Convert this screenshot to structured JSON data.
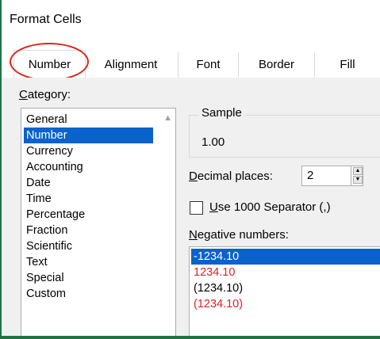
{
  "window": {
    "title": "Format Cells"
  },
  "tabs": [
    {
      "label": "Number",
      "active": true
    },
    {
      "label": "Alignment"
    },
    {
      "label": "Font"
    },
    {
      "label": "Border"
    },
    {
      "label": "Fill"
    }
  ],
  "category": {
    "label_mnemonic": "C",
    "label_rest": "ategory:",
    "selected": "Number",
    "items": [
      "General",
      "Number",
      "Currency",
      "Accounting",
      "Date",
      "Time",
      "Percentage",
      "Fraction",
      "Scientific",
      "Text",
      "Special",
      "Custom"
    ]
  },
  "sample": {
    "legend": "Sample",
    "value": "1.00"
  },
  "decimal_places": {
    "label_mnemonic": "D",
    "label_rest": "ecimal places:",
    "value": "2"
  },
  "separator": {
    "label_mnemonic": "U",
    "label_rest": "se 1000 Separator (,)",
    "checked": false
  },
  "negative_numbers": {
    "label_mnemonic": "N",
    "label_rest": "egative numbers:",
    "items": [
      {
        "text": "-1234.10",
        "color": "#000000",
        "selected": true
      },
      {
        "text": "1234.10",
        "color": "#e02020"
      },
      {
        "text": "(1234.10)",
        "color": "#000000"
      },
      {
        "text": "(1234.10)",
        "color": "#e02020"
      }
    ]
  },
  "colors": {
    "accent": "#217346",
    "selection": "#0a62cc",
    "annotation": "#d6261d"
  }
}
